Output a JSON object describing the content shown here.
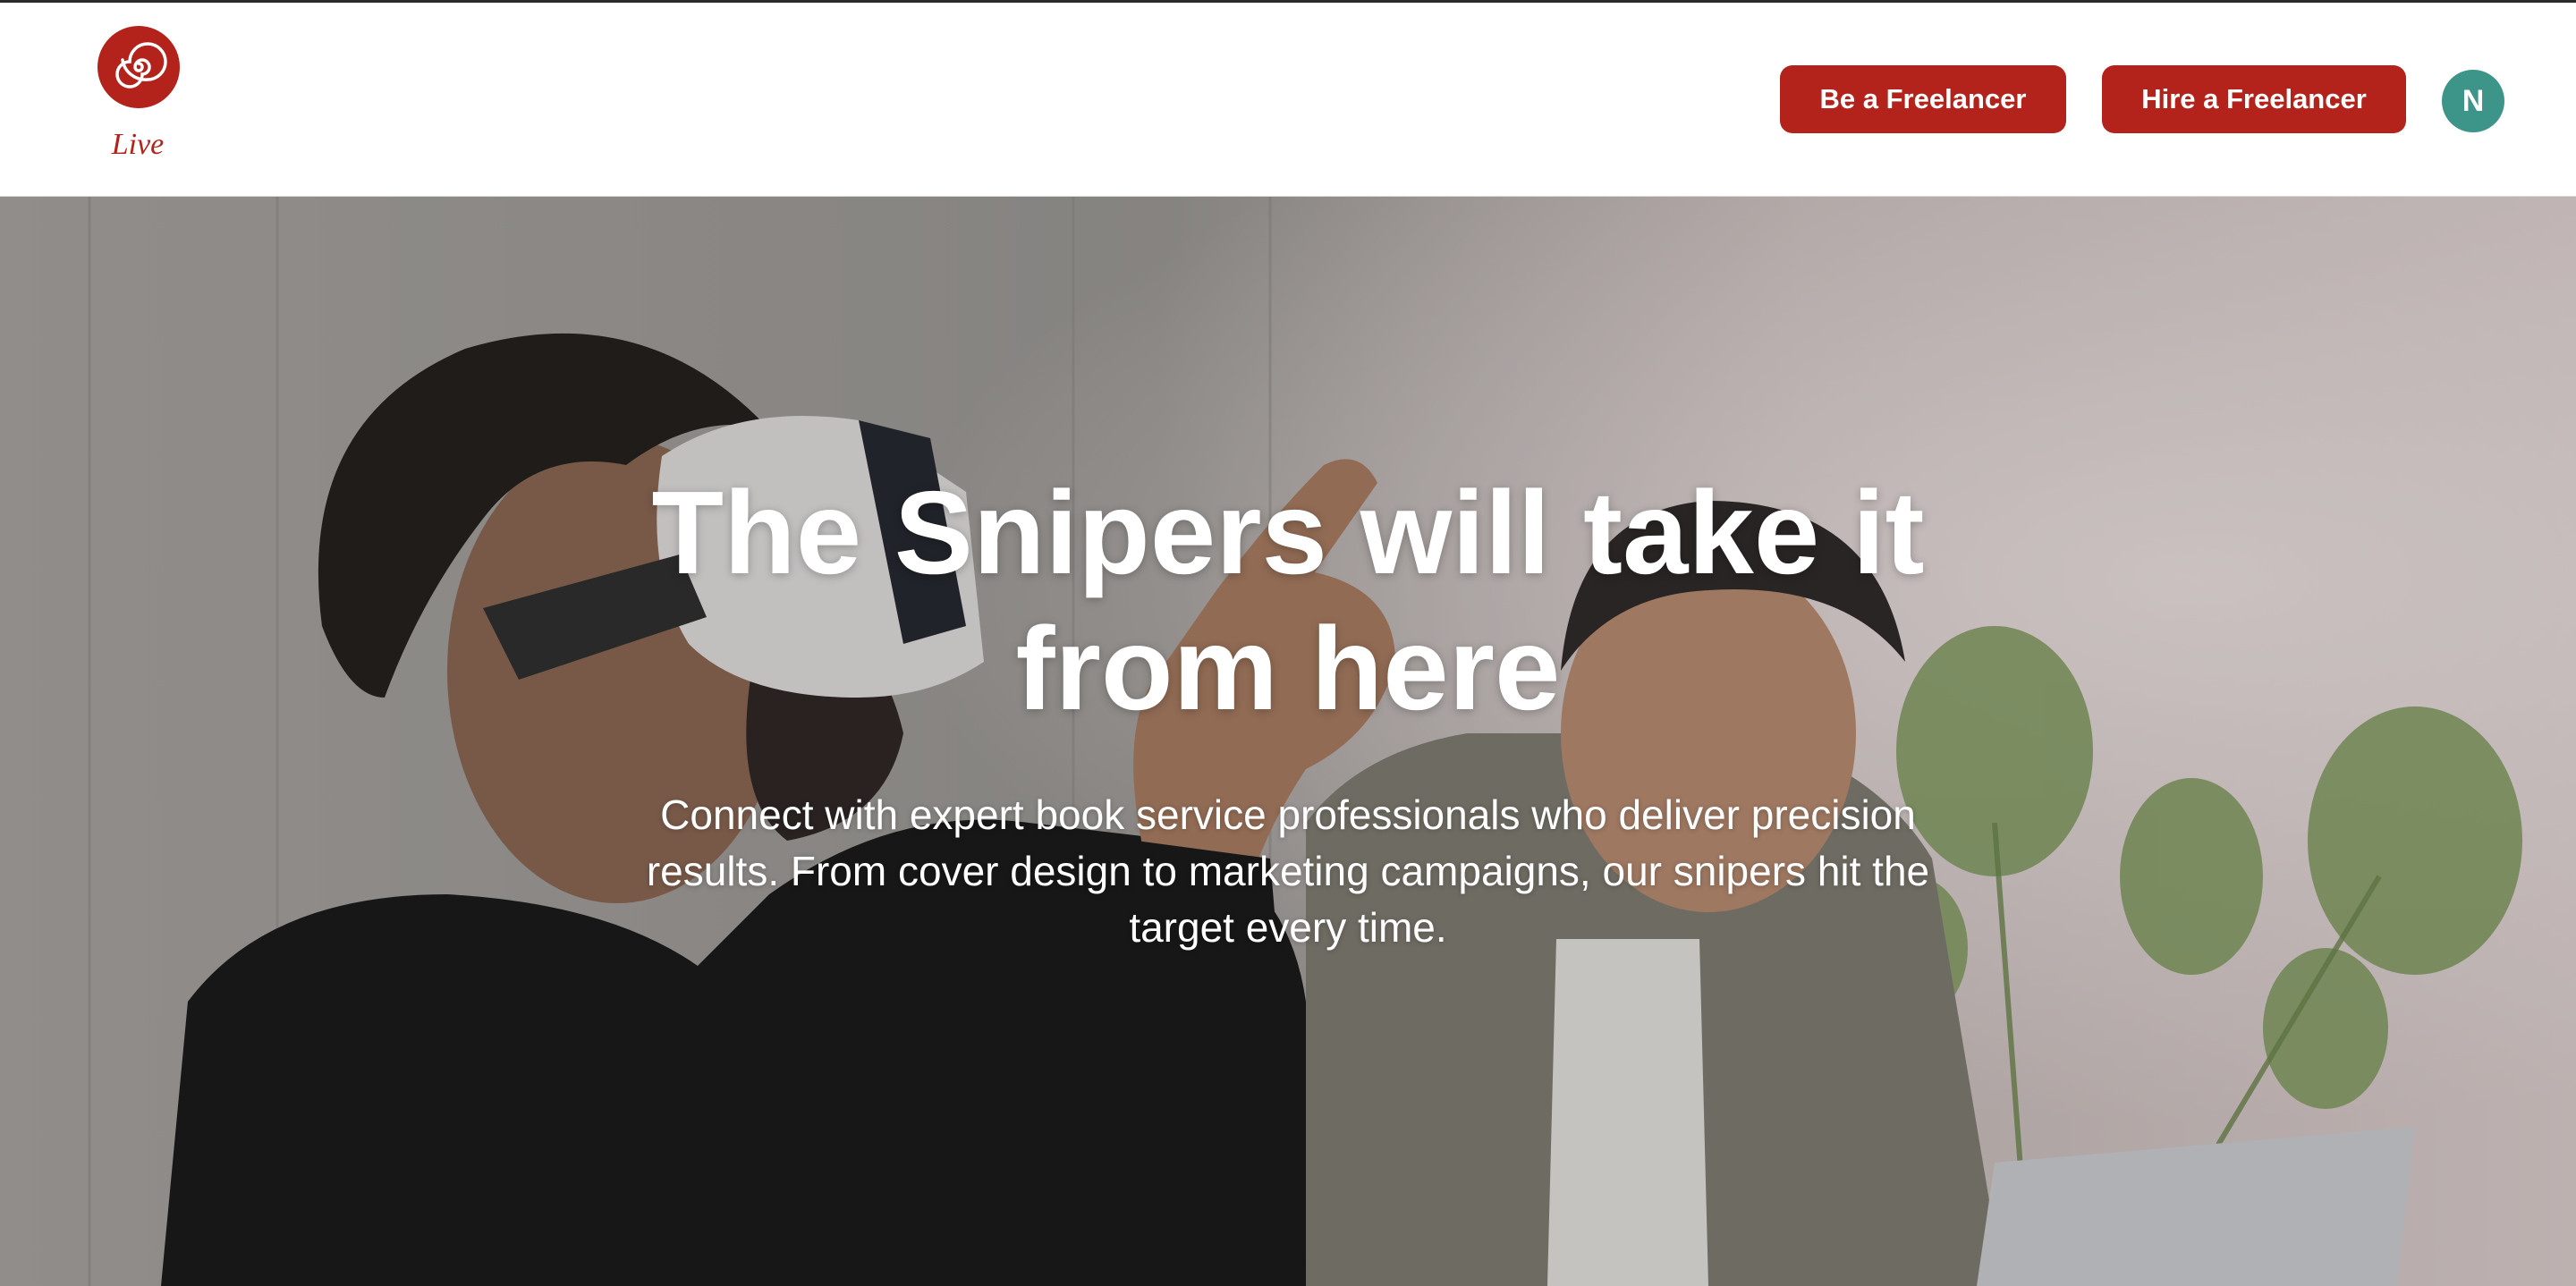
{
  "brand": {
    "logo_text": "Live",
    "color": "#b3231b"
  },
  "nav": {
    "be_freelancer_label": "Be a Freelancer",
    "hire_freelancer_label": "Hire a Freelancer",
    "button_color": "#b3231b",
    "avatar_initial": "N",
    "avatar_color": "#3d9488"
  },
  "hero": {
    "title": "The Snipers will take it from here",
    "subtitle": "Connect with expert book service professionals who deliver precision results. From cover design to marketing campaigns, our snipers hit the target every time."
  }
}
